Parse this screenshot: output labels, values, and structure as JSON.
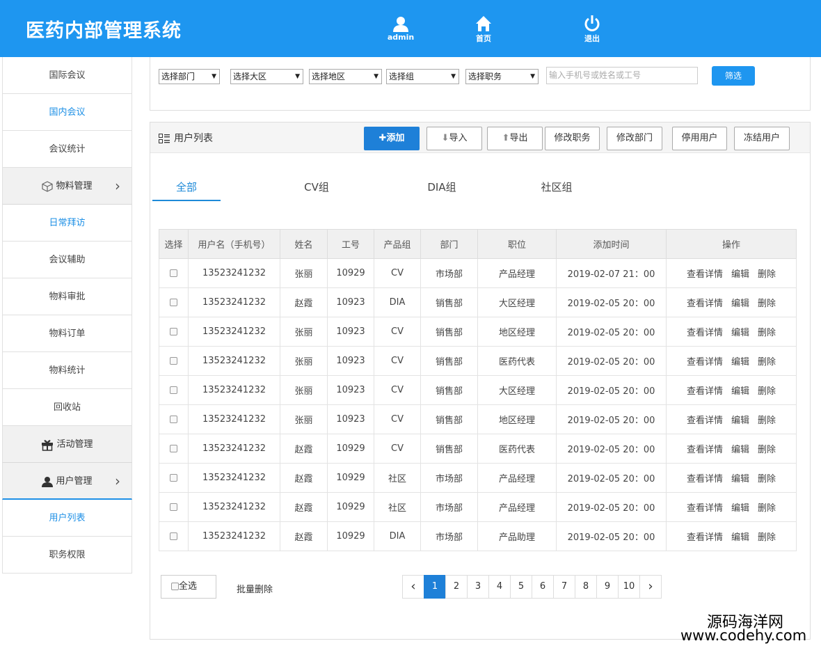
{
  "header": {
    "title": "医药内部管理系统",
    "nav": [
      {
        "label": "admin",
        "icon": "user-icon"
      },
      {
        "label": "首页",
        "icon": "home-icon"
      },
      {
        "label": "退出",
        "icon": "power-icon"
      }
    ]
  },
  "sidebar": {
    "items": [
      {
        "label": "国际会议"
      },
      {
        "label": "国内会议"
      },
      {
        "label": "会议统计"
      },
      {
        "label": "物料管理",
        "group": true,
        "icon": "box-icon"
      },
      {
        "label": "日常拜访"
      },
      {
        "label": "会议辅助"
      },
      {
        "label": "物料审批"
      },
      {
        "label": "物料订单"
      },
      {
        "label": "物料统计"
      },
      {
        "label": "回收站"
      },
      {
        "label": "活动管理",
        "group": true,
        "icon": "gift-icon"
      },
      {
        "label": "用户管理",
        "group": true,
        "icon": "person-icon"
      },
      {
        "label": "用户列表"
      },
      {
        "label": "职务权限"
      }
    ]
  },
  "filters": {
    "selects": [
      "选择部门",
      "选择大区",
      "选择地区",
      "选择组",
      "选择职务"
    ],
    "search_placeholder": "输入手机号或姓名或工号",
    "filter_button": "筛选"
  },
  "list": {
    "title": "用户列表",
    "buttons": {
      "add": "添加",
      "import": "导入",
      "export": "导出",
      "edit_position": "修改职务",
      "edit_department": "修改部门",
      "disable_user": "停用用户",
      "freeze_user": "冻结用户"
    },
    "tabs": [
      "全部",
      "CV组",
      "DIA组",
      "社区组"
    ],
    "columns": [
      "选择",
      "用户名（手机号）",
      "姓名",
      "工号",
      "产品组",
      "部门",
      "职位",
      "添加时间",
      "操作"
    ],
    "rows": [
      [
        "13523241232",
        "张丽",
        "10929",
        "CV",
        "市场部",
        "产品经理",
        "2019-02-07 21：00"
      ],
      [
        "13523241232",
        "赵霞",
        "10923",
        "DIA",
        "销售部",
        "大区经理",
        "2019-02-05 20：00"
      ],
      [
        "13523241232",
        "张丽",
        "10923",
        "CV",
        "销售部",
        "地区经理",
        "2019-02-05 20：00"
      ],
      [
        "13523241232",
        "张丽",
        "10923",
        "CV",
        "销售部",
        "医药代表",
        "2019-02-05 20：00"
      ],
      [
        "13523241232",
        "张丽",
        "10923",
        "CV",
        "销售部",
        "大区经理",
        "2019-02-05 20：00"
      ],
      [
        "13523241232",
        "张丽",
        "10923",
        "CV",
        "销售部",
        "地区经理",
        "2019-02-05 20：00"
      ],
      [
        "13523241232",
        "赵霞",
        "10929",
        "CV",
        "销售部",
        "医药代表",
        "2019-02-05 20：00"
      ],
      [
        "13523241232",
        "赵霞",
        "10929",
        "社区",
        "市场部",
        "产品经理",
        "2019-02-05 20：00"
      ],
      [
        "13523241232",
        "赵霞",
        "10929",
        "社区",
        "市场部",
        "产品经理",
        "2019-02-05 20：00"
      ],
      [
        "13523241232",
        "赵霞",
        "10929",
        "DIA",
        "市场部",
        "产品助理",
        "2019-02-05 20：00"
      ]
    ],
    "row_actions": [
      "查看详情",
      "编辑",
      "删除"
    ],
    "select_all": "全选",
    "bulk_delete": "批量删除",
    "pages": [
      "1",
      "2",
      "3",
      "4",
      "5",
      "6",
      "7",
      "8",
      "9",
      "10"
    ],
    "current_page": "1"
  },
  "watermark": {
    "line1": "源码海洋网",
    "line2": "www.codehy.com"
  },
  "colors": {
    "primary": "#1e96f0",
    "accent": "#1e80d8"
  }
}
